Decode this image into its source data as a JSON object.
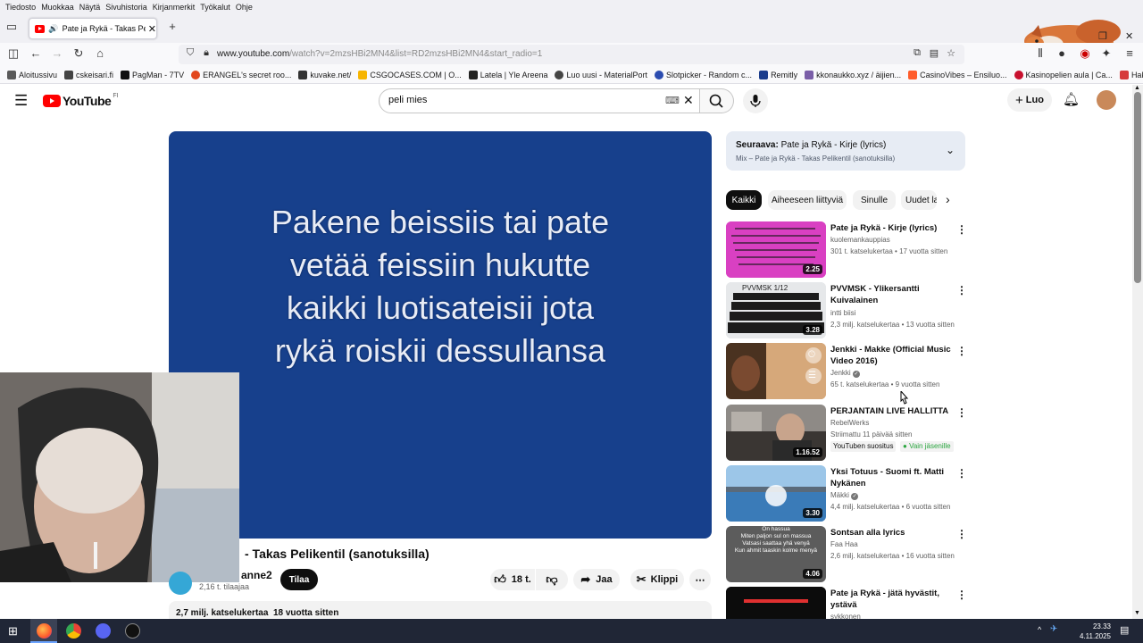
{
  "os_menu": [
    "Tiedosto",
    "Muokkaa",
    "Näytä",
    "Sivuhistoria",
    "Kirjanmerkit",
    "Työkalut",
    "Ohje"
  ],
  "tab": {
    "title": "Pate ja Rykä - Takas Pelikent"
  },
  "url": {
    "host": "www.youtube.com",
    "path": "/watch?v=2mzsHBi2MN4&list=RD2mzsHBi2MN4&start_radio=1"
  },
  "bookmarks": [
    {
      "label": "Aloitussivu",
      "color": "#5a5a5a"
    },
    {
      "label": "cskeisari.fi",
      "color": "#444"
    },
    {
      "label": "PagMan - 7TV",
      "color": "#111"
    },
    {
      "label": "ERANGEL's secret roo...",
      "color": "#e2461d"
    },
    {
      "label": "kuvake.net/",
      "color": "#333"
    },
    {
      "label": "CSGOCASES.COM | O...",
      "color": "#f7b500"
    },
    {
      "label": "Latela | Yle Areena",
      "color": "#222"
    },
    {
      "label": "Luo uusi - MaterialPort",
      "color": "#444"
    },
    {
      "label": "Slotpicker - Random c...",
      "color": "#2b4cb0"
    },
    {
      "label": "Remitly",
      "color": "#1c3d8c"
    },
    {
      "label": "kkonaukko.xyz / äijien...",
      "color": "#7a5ea8"
    },
    {
      "label": "CasinoVibes – Ensiluo...",
      "color": "#ff5c2b"
    },
    {
      "label": "Kasinopelien aula | Ca...",
      "color": "#c8102e"
    },
    {
      "label": "Haku | Elonet+",
      "color": "#d63b3b"
    }
  ],
  "youtube": {
    "logo": "YouTube",
    "country": "FI",
    "search_value": "peli mies",
    "create_label": "Luo"
  },
  "video": {
    "lyrics": [
      "Pakene beissiis tai pate",
      "vetää feissiin hukutte",
      "kaikki luotisateisii jota",
      "rykä roiskii dessullansa"
    ],
    "title": "- Takas Pelikentil (sanotuksilla)",
    "channel": "anne2",
    "subscribers": "2,16 t. tilaajaa",
    "subscribe_label": "Tilaa",
    "likes": "18 t.",
    "share_label": "Jaa",
    "clip_label": "Klippi",
    "views": "2,7 milj. katselukertaa",
    "age": "18 vuotta sitten"
  },
  "up_next": {
    "label": "Seuraava:",
    "title": "Pate ja Rykä - Kirje (lyrics)",
    "mix": "Mix – Pate ja Rykä - Takas Pelikentil (sanotuksilla)"
  },
  "chips": [
    "Kaikki",
    "Aiheeseen liittyviä",
    "Sinulle",
    "Uudet la"
  ],
  "recommendations": [
    {
      "title": "Pate ja Rykä - Kirje (lyrics)",
      "channel": "kuolemankauppias",
      "meta": "301 t. katselukertaa • 17 vuotta sitten",
      "duration": "2.25",
      "verified": false
    },
    {
      "title": "PVVMSK - Ylikersantti Kuivalainen",
      "channel": "intti biisi",
      "meta": "2,3 milj. katselukertaa • 13 vuotta sitten",
      "duration": "3.28",
      "verified": false
    },
    {
      "title": "Jenkki - Makke (Official Music Video 2016)",
      "channel": "Jenkki",
      "meta": "65 t. katselukertaa • 9 vuotta sitten",
      "duration": "",
      "verified": true
    },
    {
      "title": "PERJANTAIN LIVE HALLITTA",
      "channel": "RebelWerks",
      "meta": "Striimattu 11 päivää sitten",
      "duration": "1.16.52",
      "verified": false,
      "badge": "YouTuben suositus",
      "badge2": "Vain jäsenille"
    },
    {
      "title": "Yksi Totuus - Suomi ft. Matti Nykänen",
      "channel": "Mäkki",
      "meta": "4,4 milj. katselukertaa • 6 vuotta sitten",
      "duration": "3.30",
      "verified": true
    },
    {
      "title": "Sontsan alla lyrics",
      "channel": "Faa Haa",
      "meta": "2,6 milj. katselukertaa • 16 vuotta sitten",
      "duration": "4.06",
      "verified": false,
      "thumb_text": "On hassua\nMiten paljon sul on massua\nVatsasi saattaa yhä venyä\nKun ahmit taaskin kolme menyä"
    },
    {
      "title": "Pate ja Rykä - jätä hyvästit, ystävä",
      "channel": "sykkonen",
      "meta": "",
      "duration": "",
      "verified": false
    }
  ],
  "clock": {
    "time": "23.33",
    "date": "4.11.2025"
  }
}
